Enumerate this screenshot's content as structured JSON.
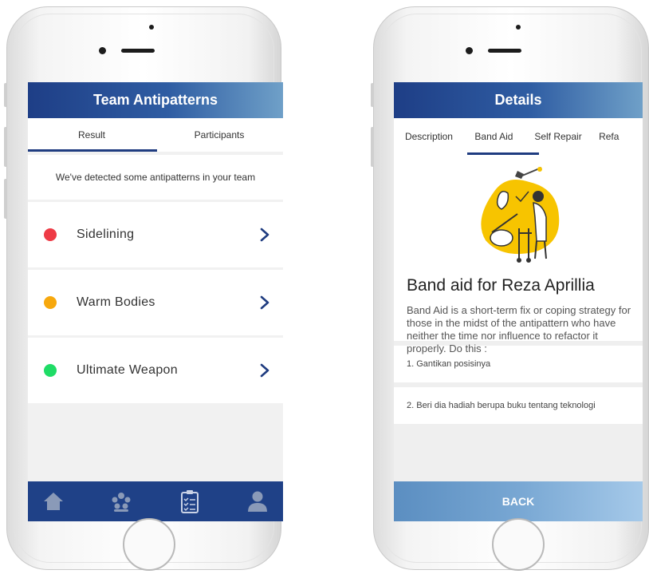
{
  "colors": {
    "brand_dark": "#1f4187",
    "dot_red": "#ee3b46",
    "dot_yellow": "#f7a80d",
    "dot_green": "#1fdc66",
    "chevron": "#1f3c80",
    "illustration_yellow": "#f7c400"
  },
  "left_screen": {
    "title": "Team Antipatterns",
    "tabs": [
      {
        "label": "Result",
        "active": true
      },
      {
        "label": "Participants",
        "active": false
      }
    ],
    "notice": "We've detected some antipatterns in your team",
    "antipatterns": [
      {
        "label": "Sidelining",
        "status_color": "red"
      },
      {
        "label": "Warm Bodies",
        "status_color": "yellow"
      },
      {
        "label": "Ultimate Weapon",
        "status_color": "green"
      }
    ],
    "bottom_nav": [
      "home-icon",
      "team-icon",
      "checklist-icon",
      "profile-icon"
    ]
  },
  "right_screen": {
    "title": "Details",
    "tabs": [
      {
        "label": "Description",
        "active": false
      },
      {
        "label": "Band Aid",
        "active": true
      },
      {
        "label": "Self Repair",
        "active": false
      },
      {
        "label": "Refa",
        "active": false
      }
    ],
    "heading": "Band aid for Reza Aprillia",
    "description": "Band Aid is a short-term fix or coping strategy for those in the midst of the antipattern who have neither the time nor influence to refactor it properly. Do this :",
    "steps": [
      "1. Gantikan posisinya",
      "2. Beri dia hadiah berupa buku tentang teknologi"
    ],
    "back_label": "BACK"
  }
}
